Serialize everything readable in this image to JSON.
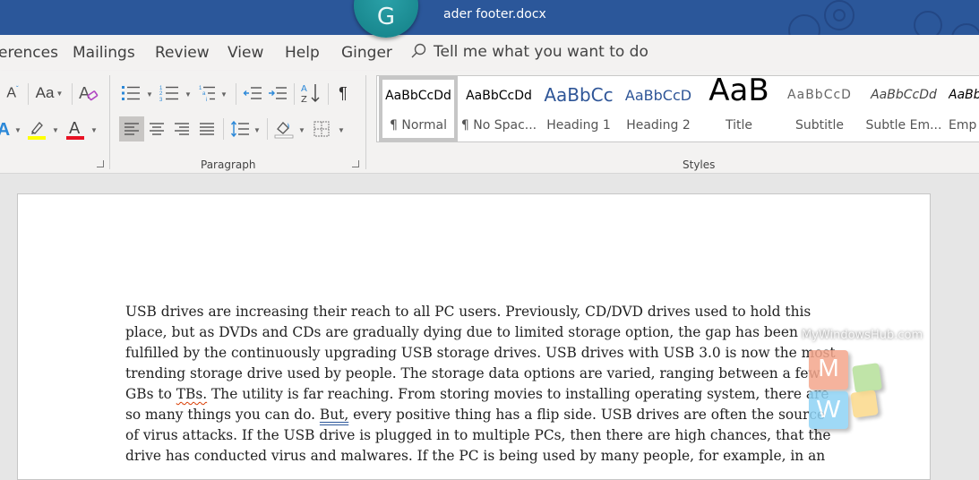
{
  "titlebar": {
    "document_title": "ader footer.docx",
    "ginger_badge_letter": "G",
    "background_color": "#2b579a"
  },
  "tabs": [
    {
      "label": "erences"
    },
    {
      "label": "Mailings"
    },
    {
      "label": "Review"
    },
    {
      "label": "View"
    },
    {
      "label": "Help"
    },
    {
      "label": "Ginger"
    }
  ],
  "tell_me": {
    "placeholder": "Tell me what you want to do"
  },
  "ribbon": {
    "font_group": {
      "grow_font_icon": "grow-font",
      "change_case_label": "Aa",
      "clear_formatting_icon": "clear-formatting",
      "text_effects_icon": "text-effects",
      "highlight_color": "#ffff00",
      "font_color": "#e81123"
    },
    "paragraph_group": {
      "label": "Paragraph",
      "buttons": [
        "Bullets",
        "Numbering",
        "Multilevel List",
        "Decrease Indent",
        "Increase Indent",
        "Sort",
        "Show/Hide ¶",
        "Align Left",
        "Center",
        "Align Right",
        "Justify",
        "Line and Paragraph Spacing",
        "Shading",
        "Borders"
      ],
      "pilcrow": "¶",
      "sort_glyph": "A Z",
      "active_alignment": "Align Left"
    },
    "styles_group": {
      "label": "Styles",
      "items": [
        {
          "preview": "AaBbCcDd",
          "name": "¶ Normal",
          "selected": true
        },
        {
          "preview": "AaBbCcDd",
          "name": "¶ No Spac..."
        },
        {
          "preview": "AaBbCc",
          "name": "Heading 1"
        },
        {
          "preview": "AaBbCcD",
          "name": "Heading 2"
        },
        {
          "preview": "AaB",
          "name": "Title"
        },
        {
          "preview": "AaBbCcD",
          "name": "Subtitle"
        },
        {
          "preview": "AaBbCcDd",
          "name": "Subtle Em..."
        },
        {
          "preview": "AaBb",
          "name": "Emp"
        }
      ]
    }
  },
  "document": {
    "lines": [
      [
        {
          "t": "USB drives are increasing their reach to all PC users. Previously, CD/DVD drives used to hold this"
        }
      ],
      [
        {
          "t": "place, but as DVDs and CDs are gradually dying due to limited storage option, the gap has been"
        }
      ],
      [
        {
          "t": "fulfilled by the continuously upgrading USB storage drives. USB drives with USB 3.0 is now the most"
        }
      ],
      [
        {
          "t": "trending storage drive used by people. The storage data options are varied, ranging between a few"
        }
      ],
      [
        {
          "t": "GBs to "
        },
        {
          "t": "TBs.",
          "mark": "spell"
        },
        {
          "t": " The utility is far reaching. From storing movies to installing operating system, there are"
        }
      ],
      [
        {
          "t": "so many things you can do. "
        },
        {
          "t": "But,",
          "mark": "gram"
        },
        {
          "t": " every positive thing has a flip side. USB drives are often the source"
        }
      ],
      [
        {
          "t": "of virus attacks. If the USB drive is plugged in to multiple PCs, then there are high chances, that the"
        }
      ],
      [
        {
          "t": "drive has conducted virus and malwares. If the PC is being used by many people, for example, in an"
        }
      ]
    ]
  },
  "watermark": {
    "text": "MyWindowsHub.com",
    "letters": [
      "M",
      "W"
    ],
    "colors": [
      "#f4a68c",
      "#b6e09a",
      "#8fd3f5",
      "#fbd98a"
    ]
  }
}
